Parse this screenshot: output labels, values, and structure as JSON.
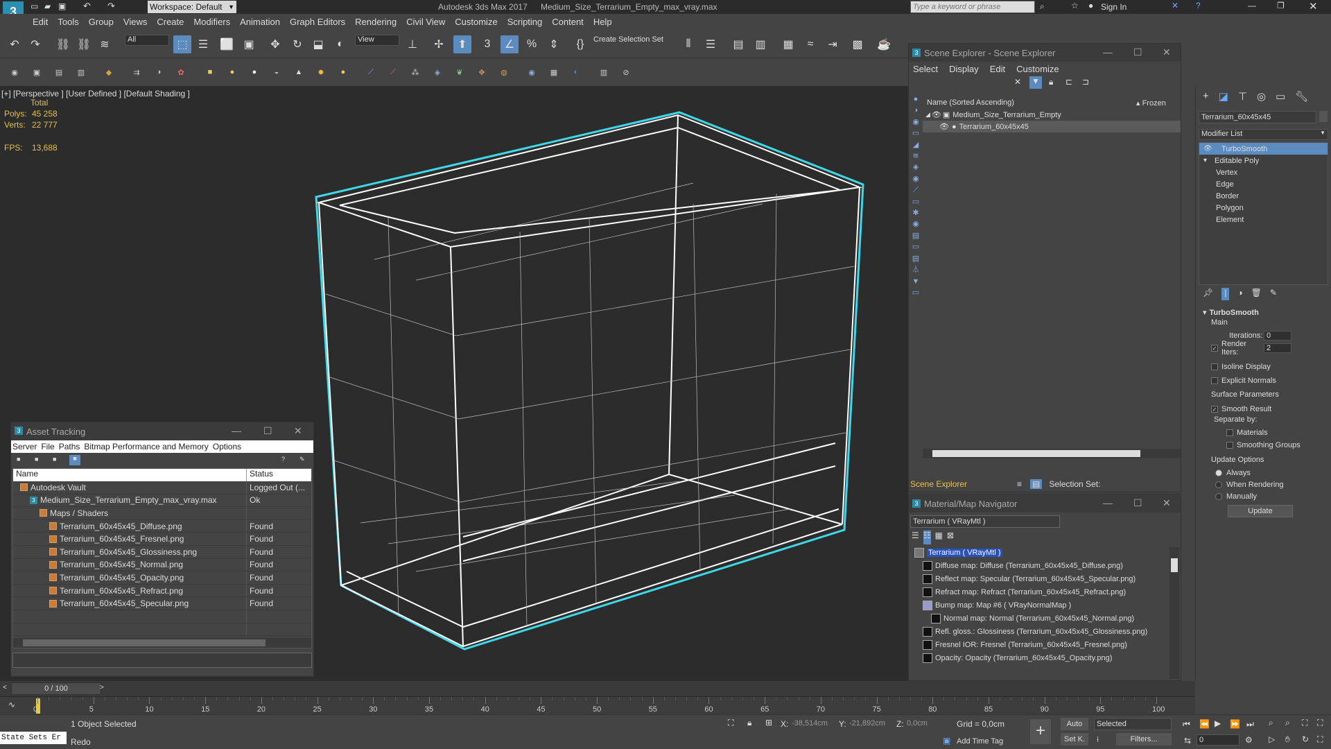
{
  "titlebar": {
    "workspace": "Workspace: Default",
    "app_title": "Autodesk 3ds Max 2017",
    "file_name": "Medium_Size_Terrarium_Empty_max_vray.max",
    "search_placeholder": "Type a keyword or phrase",
    "sign_in": "Sign In"
  },
  "menu": [
    "Edit",
    "Tools",
    "Group",
    "Views",
    "Create",
    "Modifiers",
    "Animation",
    "Graph Editors",
    "Rendering",
    "Civil View",
    "Customize",
    "Scripting",
    "Content",
    "Help"
  ],
  "toolbar": {
    "selection_filter": "All",
    "ref_coord": "View",
    "selection_set": "Create Selection Set"
  },
  "viewport": {
    "label_plus": "[+]",
    "label_view": "[Perspective ]",
    "label_user": "[User Defined ]",
    "label_shading": "[Default Shading ]",
    "total": "Total",
    "polys_label": "Polys:",
    "polys_value": "45 258",
    "verts_label": "Verts:",
    "verts_value": "22 777",
    "fps_label": "FPS:",
    "fps_value": "13,688",
    "wire_color": "#ffffff",
    "outline_color": "#3ed8e8"
  },
  "asset_tracking": {
    "title": "Asset Tracking",
    "menu": [
      "Server",
      "File",
      "Paths",
      "Bitmap Performance and Memory",
      "Options"
    ],
    "col_name": "Name",
    "col_status": "Status",
    "rows": [
      {
        "name": "Autodesk Vault",
        "status": "Logged Out (...",
        "indent": 0,
        "icon": "vault"
      },
      {
        "name": "Medium_Size_Terrarium_Empty_max_vray.max",
        "status": "Ok",
        "indent": 1,
        "icon": "max"
      },
      {
        "name": "Maps / Shaders",
        "status": "",
        "indent": 2,
        "icon": "folder"
      },
      {
        "name": "Terrarium_60x45x45_Diffuse.png",
        "status": "Found",
        "indent": 3,
        "icon": "file"
      },
      {
        "name": "Terrarium_60x45x45_Fresnel.png",
        "status": "Found",
        "indent": 3,
        "icon": "file"
      },
      {
        "name": "Terrarium_60x45x45_Glossiness.png",
        "status": "Found",
        "indent": 3,
        "icon": "file"
      },
      {
        "name": "Terrarium_60x45x45_Normal.png",
        "status": "Found",
        "indent": 3,
        "icon": "file"
      },
      {
        "name": "Terrarium_60x45x45_Opacity.png",
        "status": "Found",
        "indent": 3,
        "icon": "file"
      },
      {
        "name": "Terrarium_60x45x45_Refract.png",
        "status": "Found",
        "indent": 3,
        "icon": "file"
      },
      {
        "name": "Terrarium_60x45x45_Specular.png",
        "status": "Found",
        "indent": 3,
        "icon": "file"
      }
    ]
  },
  "scene_explorer": {
    "title": "Scene Explorer - Scene Explorer",
    "menu": [
      "Select",
      "Display",
      "Edit",
      "Customize"
    ],
    "col_name": "Name (Sorted Ascending)",
    "col_frozen": "▴ Frozen",
    "items": [
      {
        "name": "Medium_Size_Terrarium_Empty",
        "selected": false
      },
      {
        "name": "Terrarium_60x45x45",
        "selected": true
      }
    ],
    "footer_label": "Scene Explorer",
    "selection_set": "Selection Set:"
  },
  "material_navigator": {
    "title": "Material/Map Navigator",
    "current": "Terrarium  ( VRayMtl )",
    "items": [
      {
        "label": "Terrarium  ( VRayMtl )",
        "selected": true,
        "indent": 0
      },
      {
        "label": "Diffuse map: Diffuse (Terrarium_60x45x45_Diffuse.png)",
        "indent": 1
      },
      {
        "label": "Reflect map: Specular (Terrarium_60x45x45_Specular.png)",
        "indent": 1
      },
      {
        "label": "Refract map: Refract (Terrarium_60x45x45_Refract.png)",
        "indent": 1
      },
      {
        "label": "Bump map: Map #6  ( VRayNormalMap )",
        "indent": 1
      },
      {
        "label": "Normal map: Normal (Terrarium_60x45x45_Normal.png)",
        "indent": 2
      },
      {
        "label": "Refl. gloss.: Glossiness (Terrarium_60x45x45_Glossiness.png)",
        "indent": 1
      },
      {
        "label": "Fresnel IOR: Fresnel (Terrarium_60x45x45_Fresnel.png)",
        "indent": 1
      },
      {
        "label": "Opacity: Opacity (Terrarium_60x45x45_Opacity.png)",
        "indent": 1
      }
    ]
  },
  "command_panel": {
    "object_name": "Terrarium_60x45x45",
    "modifier_list": "Modifier List",
    "stack": [
      {
        "label": "TurboSmooth",
        "selected": true,
        "indent": 0
      },
      {
        "label": "Editable Poly",
        "indent": 0
      },
      {
        "label": "Vertex",
        "indent": 1
      },
      {
        "label": "Edge",
        "indent": 1
      },
      {
        "label": "Border",
        "indent": 1
      },
      {
        "label": "Polygon",
        "indent": 1
      },
      {
        "label": "Element",
        "indent": 1
      }
    ],
    "rollout_title": "TurboSmooth",
    "main": "Main",
    "iterations_label": "Iterations:",
    "iterations_value": "0",
    "render_iters_label": "Render Iters:",
    "render_iters_value": "2",
    "isoline": "Isoline Display",
    "explicit_normals": "Explicit Normals",
    "surface_params": "Surface Parameters",
    "smooth_result": "Smooth Result",
    "separate_by": "Separate by:",
    "materials": "Materials",
    "smoothing_groups": "Smoothing Groups",
    "update_options": "Update Options",
    "always": "Always",
    "when_rendering": "When Rendering",
    "manually": "Manually",
    "update_btn": "Update"
  },
  "timeline": {
    "frame": "0 / 100",
    "ticks": [
      0,
      5,
      10,
      15,
      20,
      25,
      30,
      35,
      40,
      45,
      50,
      55,
      60,
      65,
      70,
      75,
      80,
      85,
      90,
      95,
      100
    ]
  },
  "status": {
    "state_sets": "State Sets Er",
    "objects_selected": "1 Object Selected",
    "last_action": "Redo",
    "x_label": "X:",
    "x_value": "-38,514cm",
    "y_label": "Y:",
    "y_value": "-21,892cm",
    "z_label": "Z:",
    "z_value": "0,0cm",
    "grid": "Grid = 0,0cm",
    "add_time_tag": "Add Time Tag",
    "auto": "Auto",
    "selected": "Selected",
    "set_k": "Set K.",
    "filters": "Filters...",
    "frame_value": "0"
  }
}
